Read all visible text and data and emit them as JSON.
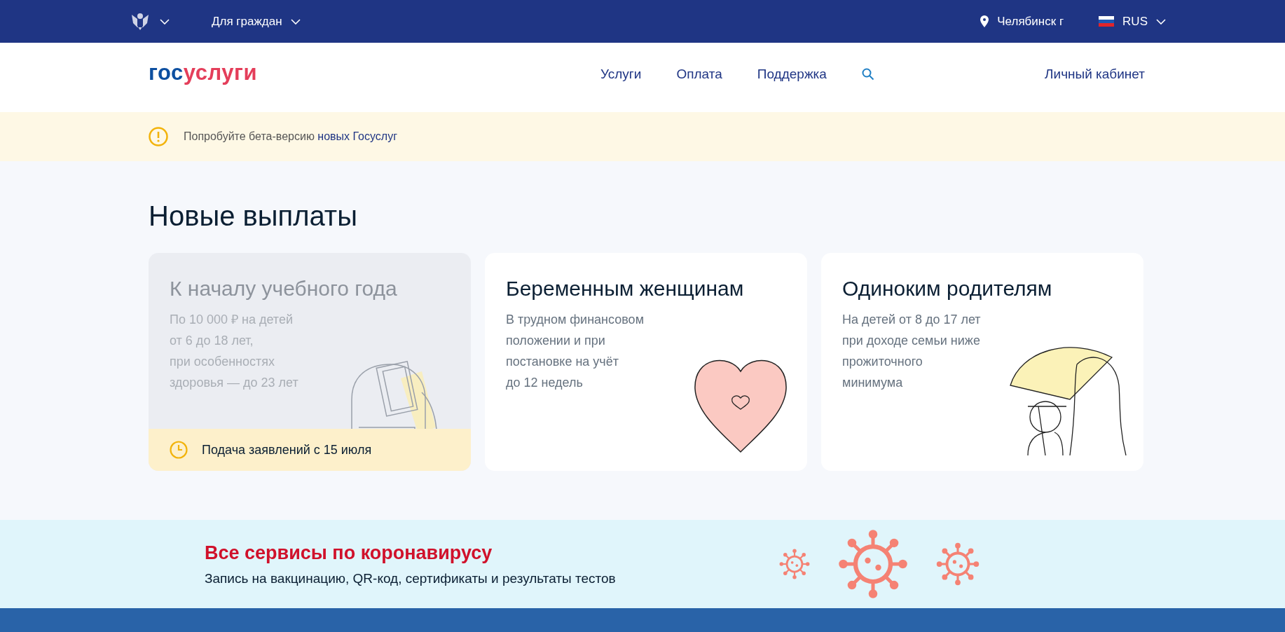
{
  "top_bar": {
    "audience": "Для граждан",
    "location": "Челябинск г",
    "language": "RUS"
  },
  "header": {
    "logo": {
      "prefix": "гос",
      "suffix": "услуги"
    },
    "nav": [
      "Услуги",
      "Оплата",
      "Поддержка"
    ],
    "account": "Личный кабинет"
  },
  "beta_banner": {
    "text": "Попробуйте бета-версию ",
    "link": "новых Госуслуг"
  },
  "section_title": "Новые выплаты",
  "cards": [
    {
      "title": "К началу учебного года",
      "description": [
        "По 10 000 ₽ на детей",
        "от 6 до 18 лет,",
        "при особенностях",
        "здоровья — до 23 лет"
      ],
      "disabled": true,
      "notice": "Подача заявлений с 15 июля"
    },
    {
      "title": "Беременным женщинам",
      "description": [
        "В трудном финансовом",
        "положении и при",
        "постановке на учёт",
        "до 12 недель"
      ],
      "disabled": false
    },
    {
      "title": "Одиноким родителям",
      "description": [
        "На детей от 8 до 17 лет",
        "при доходе семьи ниже",
        "прожиточного",
        "минимума"
      ],
      "disabled": false
    }
  ],
  "covid_banner": {
    "title": "Все сервисы по коронавирусу",
    "subtitle": "Запись на вакцинацию, QR-код, сертификаты и результаты тестов"
  }
}
